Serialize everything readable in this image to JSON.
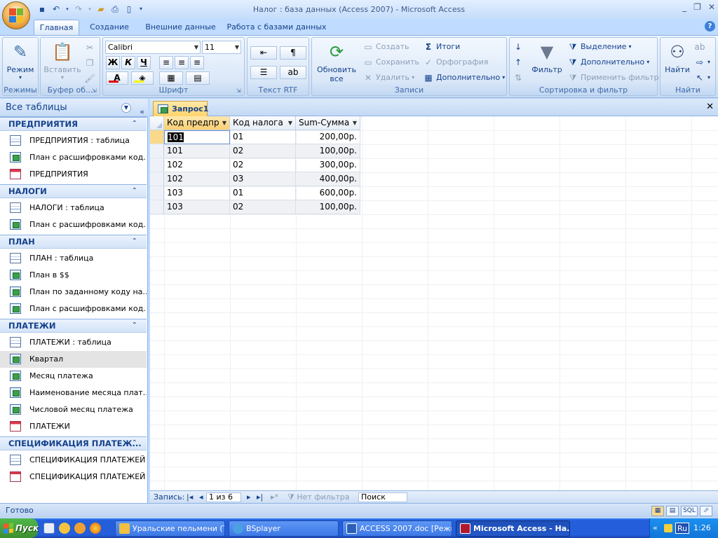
{
  "window": {
    "title": "Налог : база данных (Access 2007) - Microsoft Access",
    "controls": [
      "_",
      "❐",
      "✕"
    ]
  },
  "ribbon_tabs": [
    "Главная",
    "Создание",
    "Внешние данные",
    "Работа с базами данных"
  ],
  "active_tab": "Главная",
  "ribbon": {
    "groups": [
      "Режимы",
      "Буфер об...",
      "Шрифт",
      "Текст RTF",
      "Записи",
      "Сортировка и фильтр",
      "Найти"
    ],
    "mode_btn": "Режим",
    "paste_btn": "Вставить",
    "font_name": "Calibri",
    "font_size": "11",
    "bold": "Ж",
    "italic": "К",
    "underline": "Ч",
    "refresh_btn_1": "Обновить",
    "refresh_btn_2": "все",
    "create": "Создать",
    "save": "Сохранить",
    "delete": "Удалить",
    "totals": "Итоги",
    "spelling": "Орфография",
    "more": "Дополнительно",
    "filter_btn": "Фильтр",
    "selection": "Выделение",
    "advanced": "Дополнительно",
    "apply_filter": "Применить фильтр",
    "find_btn": "Найти"
  },
  "nav": {
    "header": "Все таблицы",
    "sections": [
      {
        "title": "ПРЕДПРИЯТИЯ",
        "items": [
          {
            "label": "ПРЕДПРИЯТИЯ : таблица",
            "icon": "table"
          },
          {
            "label": "План с расшифровками код...",
            "icon": "query"
          },
          {
            "label": "ПРЕДПРИЯТИЯ",
            "icon": "form"
          }
        ]
      },
      {
        "title": "НАЛОГИ",
        "items": [
          {
            "label": "НАЛОГИ : таблица",
            "icon": "table"
          },
          {
            "label": "План с расшифровками код...",
            "icon": "query"
          }
        ]
      },
      {
        "title": "ПЛАН",
        "items": [
          {
            "label": "ПЛАН : таблица",
            "icon": "table"
          },
          {
            "label": "План в $$",
            "icon": "query"
          },
          {
            "label": "План по заданному коду на...",
            "icon": "query"
          },
          {
            "label": "План с расшифровками код...",
            "icon": "query"
          }
        ]
      },
      {
        "title": "ПЛАТЕЖИ",
        "items": [
          {
            "label": "ПЛАТЕЖИ : таблица",
            "icon": "table"
          },
          {
            "label": "Квартал",
            "icon": "query"
          },
          {
            "label": "Месяц платежа",
            "icon": "query"
          },
          {
            "label": "Наименование месяца плат...",
            "icon": "query"
          },
          {
            "label": "Числовой месяц платежа",
            "icon": "query"
          },
          {
            "label": "ПЛАТЕЖИ",
            "icon": "form"
          }
        ]
      },
      {
        "title": "СПЕЦИФИКАЦИЯ ПЛАТЕЖ...",
        "items": [
          {
            "label": "СПЕЦИФИКАЦИЯ ПЛАТЕЖЕЙ ...",
            "icon": "table"
          },
          {
            "label": "СПЕЦИФИКАЦИЯ ПЛАТЕЖЕЙ ...",
            "icon": "form"
          }
        ]
      }
    ]
  },
  "document": {
    "tab": "Запрос1",
    "columns": [
      "Код предпр",
      "Код налога",
      "Sum-Сумма"
    ],
    "rows": [
      [
        "101",
        "01",
        "200,00р."
      ],
      [
        "101",
        "02",
        "100,00р."
      ],
      [
        "102",
        "02",
        "300,00р."
      ],
      [
        "102",
        "03",
        "400,00р."
      ],
      [
        "103",
        "01",
        "600,00р."
      ],
      [
        "103",
        "02",
        "100,00р."
      ]
    ],
    "record_nav": {
      "label": "Запись:",
      "position": "1 из 6",
      "filter": "Нет фильтра",
      "search": "Поиск"
    }
  },
  "status": {
    "text": "Готово",
    "views": [
      "▦",
      "▤",
      "SQL",
      "⬀"
    ]
  },
  "taskbar": {
    "start": "Пуск",
    "tasks": [
      "Уральские пельмени (Т...",
      "BSplayer",
      "ACCESS 2007.doc [Режи...",
      "Microsoft Access - На..."
    ],
    "lang": "Ru",
    "clock": "1:26"
  }
}
